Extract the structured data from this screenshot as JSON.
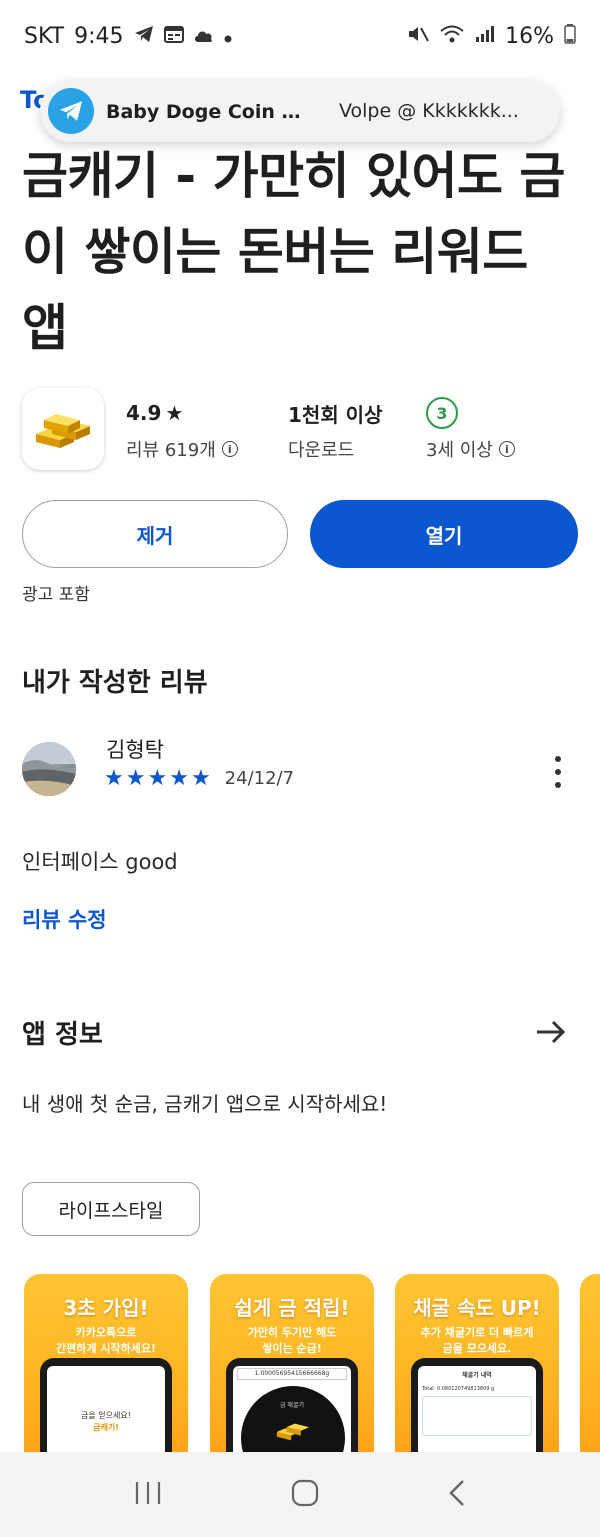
{
  "status_bar": {
    "carrier": "SKT",
    "time": "9:45",
    "battery": "16%"
  },
  "notification": {
    "title": "Baby Doge Coin 🇧🇷...",
    "subtitle": "Volpe @ Kkkkkkk..."
  },
  "developer_fragment": "To",
  "app": {
    "title": "금캐기 - 가만히 있어도 금이 쌓이는 돈버는 리워드 앱",
    "rating": "4.9",
    "reviews_label": "리뷰 619개",
    "downloads_value": "1천회 이상",
    "downloads_label": "다운로드",
    "age_badge": "3",
    "age_label": "3세 이상"
  },
  "actions": {
    "remove_label": "제거",
    "open_label": "열기"
  },
  "ads_note": "광고 포함",
  "my_review": {
    "section_title": "내가 작성한 리뷰",
    "reviewer": "김형탁",
    "stars": 5,
    "date": "24/12/7",
    "text": "인터페이스 good",
    "edit_label": "리뷰 수정"
  },
  "about": {
    "section_title": "앱 정보",
    "description": "내 생애 첫 순금, 금캐기 앱으로 시작하세요!",
    "category_chip": "라이프스타일"
  },
  "screenshots": [
    {
      "title": "3초 가입!",
      "subtitle_1": "카카오톡으로",
      "subtitle_2": "간편하게 시작하세요!",
      "screen_text_1": "금을 얻으세요!",
      "screen_text_2": "금캐기!"
    },
    {
      "title": "쉽게 금 적립!",
      "subtitle_1": "가만히 두기만 해도",
      "subtitle_2": "쌓이는 순금!",
      "screen_text_1": "1.00005695415666668g",
      "screen_text_2": "금 채굴기"
    },
    {
      "title": "채굴 속도 UP!",
      "subtitle_1": "추가 채굴기로 더 빠르게",
      "subtitle_2": "금을 모으세요.",
      "screen_text_1": "채굴기 내역",
      "screen_text_2": "Total: 0.080120749813809 g"
    }
  ]
}
